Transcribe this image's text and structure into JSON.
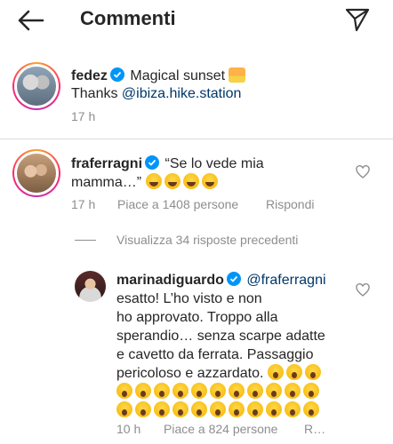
{
  "header": {
    "title": "Commenti"
  },
  "post": {
    "username": "fedez",
    "caption_text": "Magical sunset",
    "caption_emoji": "sunset-emoji",
    "thanks_text": "Thanks",
    "thanks_mention": "@ibiza.hike.station",
    "time": "17 h"
  },
  "comments": [
    {
      "username": "fraferragni",
      "text_line1": "“Se lo vede mia",
      "text_line2": "mamma…”",
      "emoji": "laughing-tears-emoji x4",
      "time": "17 h",
      "likes": "Piace a 1408 persone",
      "reply": "Rispondi"
    }
  ],
  "view_replies": "Visualizza 34 risposte precedenti",
  "reply": {
    "username": "marinadiguardo",
    "mention": "@fraferragni",
    "lines": [
      "esatto! L’ho visto e non",
      "ho approvato. Troppo alla",
      "sperandio… senza scarpe adatte",
      "e cavetto da ferrata. Passaggio",
      "pericoloso e azzardato."
    ],
    "emoji": "screaming-face-emoji",
    "time": "10 h",
    "likes": "Piace a 824 persone",
    "reply_truncated": "R…"
  },
  "colors": {
    "text": "#262626",
    "secondary": "#8e8e8e",
    "link": "#00376b",
    "verified": "#0095f6"
  }
}
